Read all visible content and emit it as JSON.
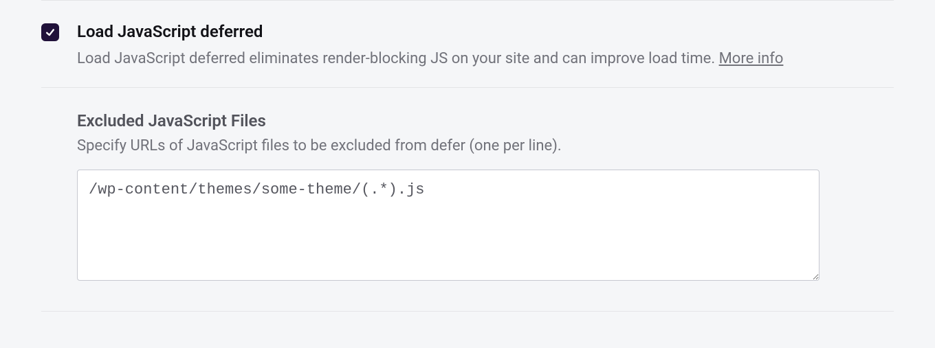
{
  "defer": {
    "title": "Load JavaScript deferred",
    "description": "Load JavaScript deferred eliminates render-blocking JS on your site and can improve load time. ",
    "more_info": "More info",
    "checked": true
  },
  "excluded": {
    "title": "Excluded JavaScript Files",
    "description": "Specify URLs of JavaScript files to be excluded from defer (one per line).",
    "value": "/wp-content/themes/some-theme/(.*).js"
  }
}
